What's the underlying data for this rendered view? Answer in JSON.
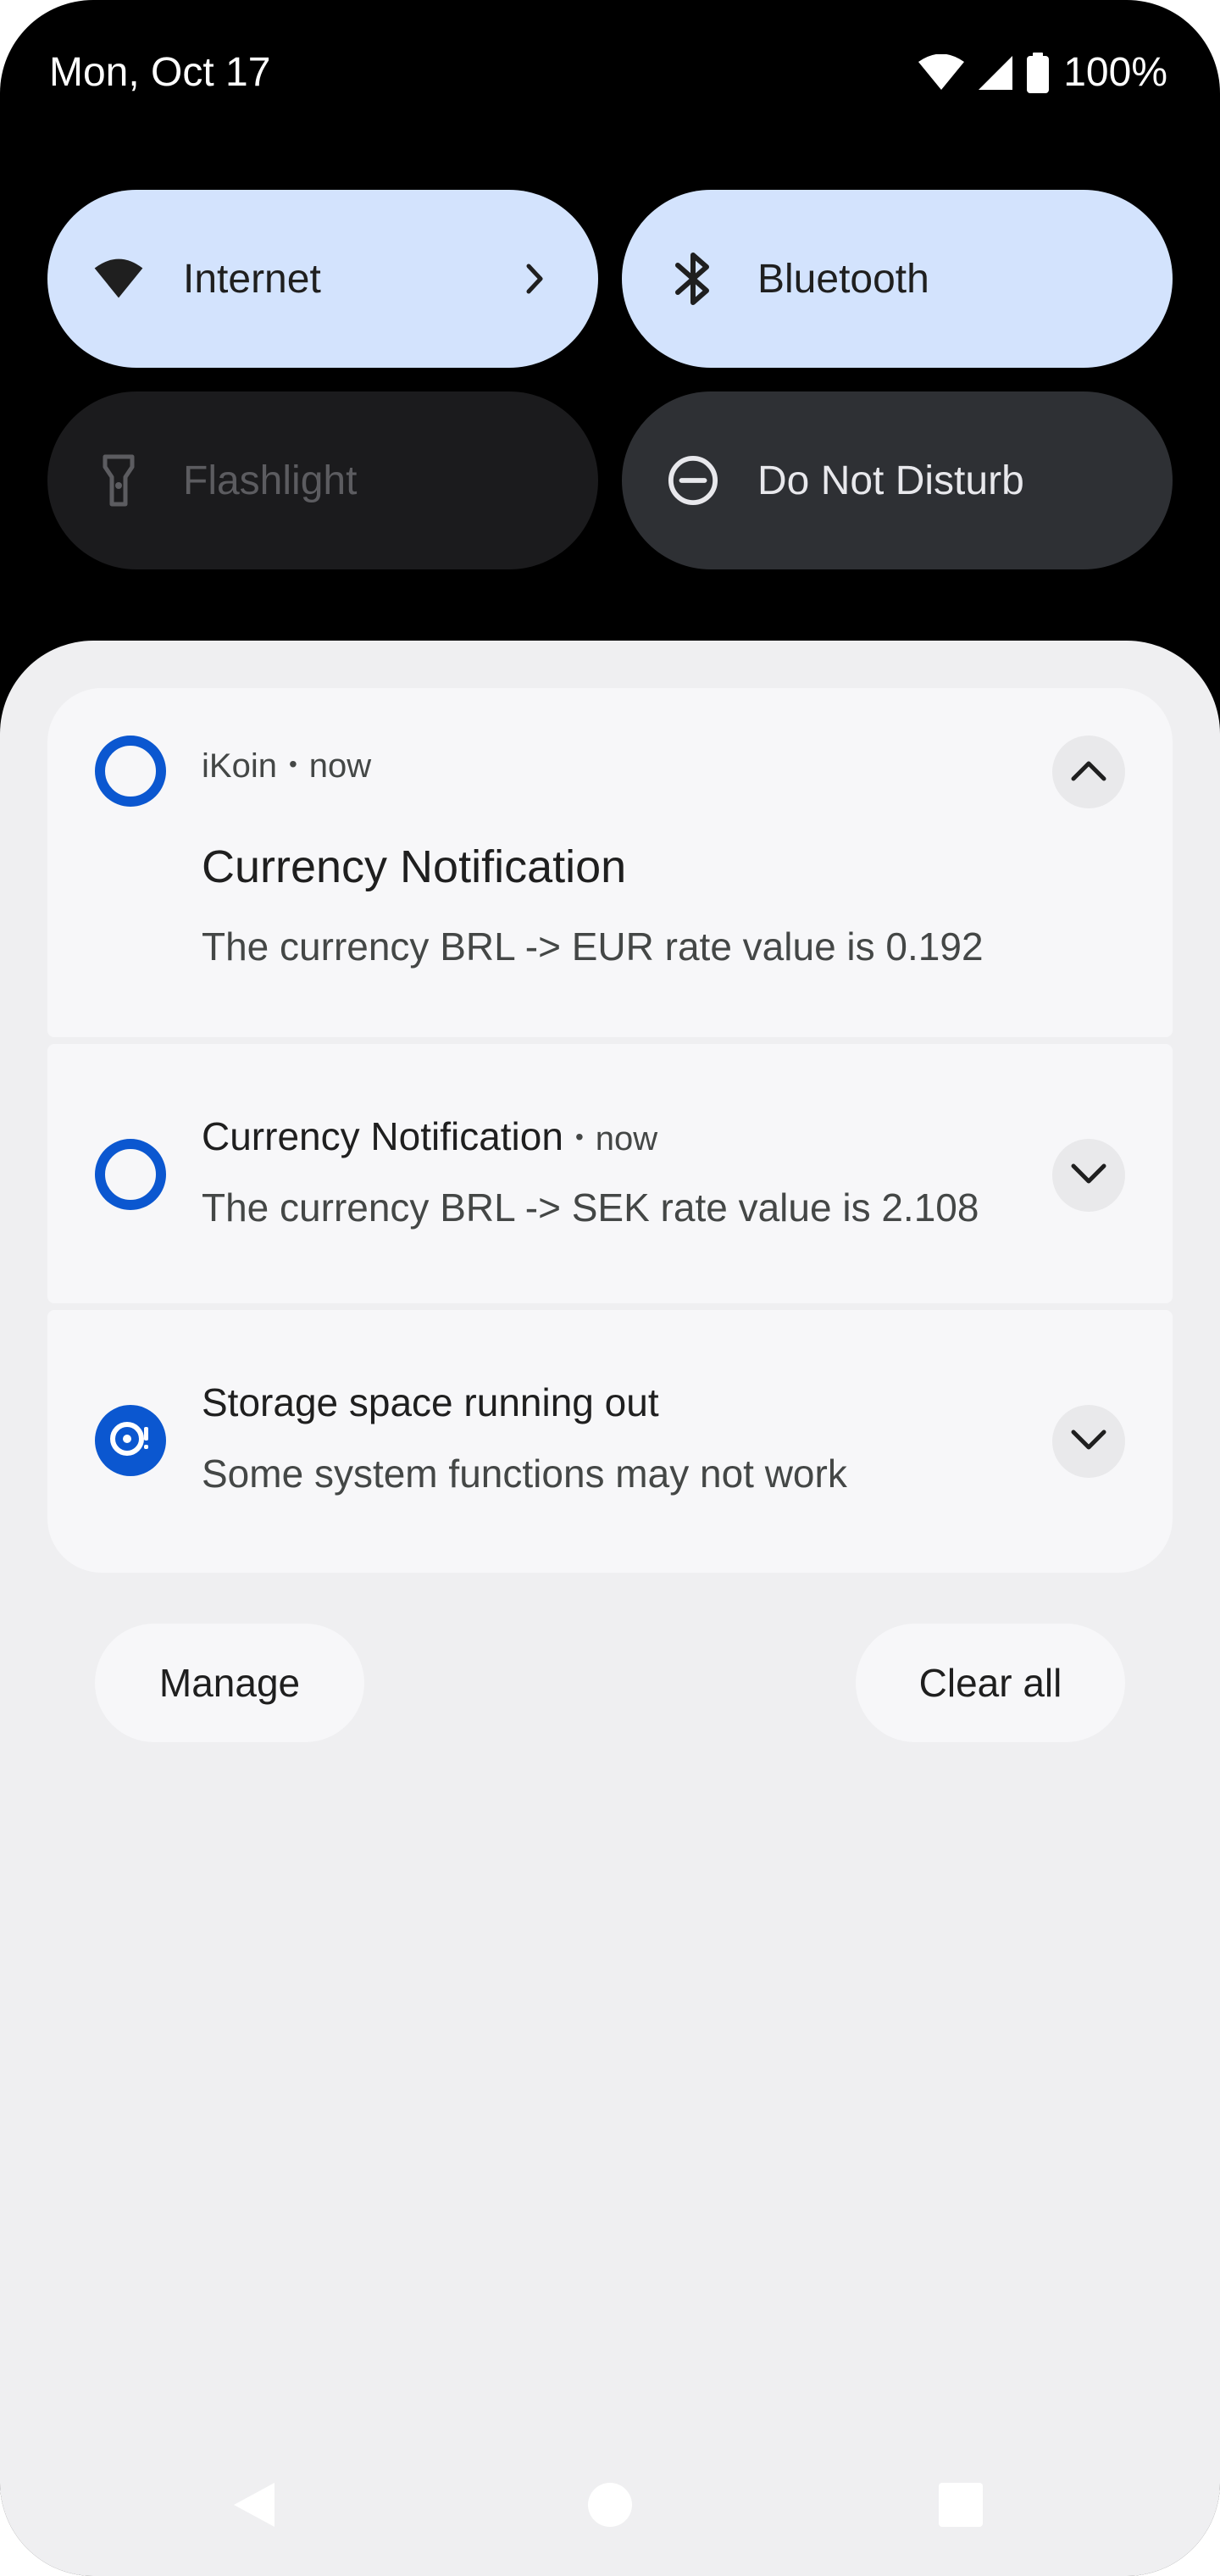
{
  "status_bar": {
    "date": "Mon, Oct 17",
    "battery": "100%",
    "icons": [
      "wifi-icon",
      "signal-icon",
      "battery-icon"
    ]
  },
  "quick_settings": {
    "tiles": [
      {
        "label": "Internet",
        "icon": "wifi-icon",
        "state": "on",
        "has_chevron": true
      },
      {
        "label": "Bluetooth",
        "icon": "bluetooth-icon",
        "state": "on"
      },
      {
        "label": "Flashlight",
        "icon": "flashlight-icon",
        "state": "unavailable"
      },
      {
        "label": "Do Not Disturb",
        "icon": "do-not-disturb-icon",
        "state": "off"
      }
    ]
  },
  "notifications": [
    {
      "app": "iKoin",
      "time": "now",
      "title": "Currency Notification",
      "text": "The currency BRL -> EUR rate value is 0.192",
      "expanded": true
    },
    {
      "title": "Currency Notification",
      "time": "now",
      "text": "The currency BRL -> SEK rate value is 2.108",
      "expanded": false
    },
    {
      "title": "Storage space running out",
      "text": "Some system functions may not work",
      "expanded": false
    }
  ],
  "actions": {
    "manage": "Manage",
    "clear_all": "Clear all"
  },
  "colors": {
    "accent": "#0b57d0",
    "tile_on": "#d3e3fd",
    "shade_bg": "#efeff1",
    "card_bg": "#f7f7f9"
  }
}
